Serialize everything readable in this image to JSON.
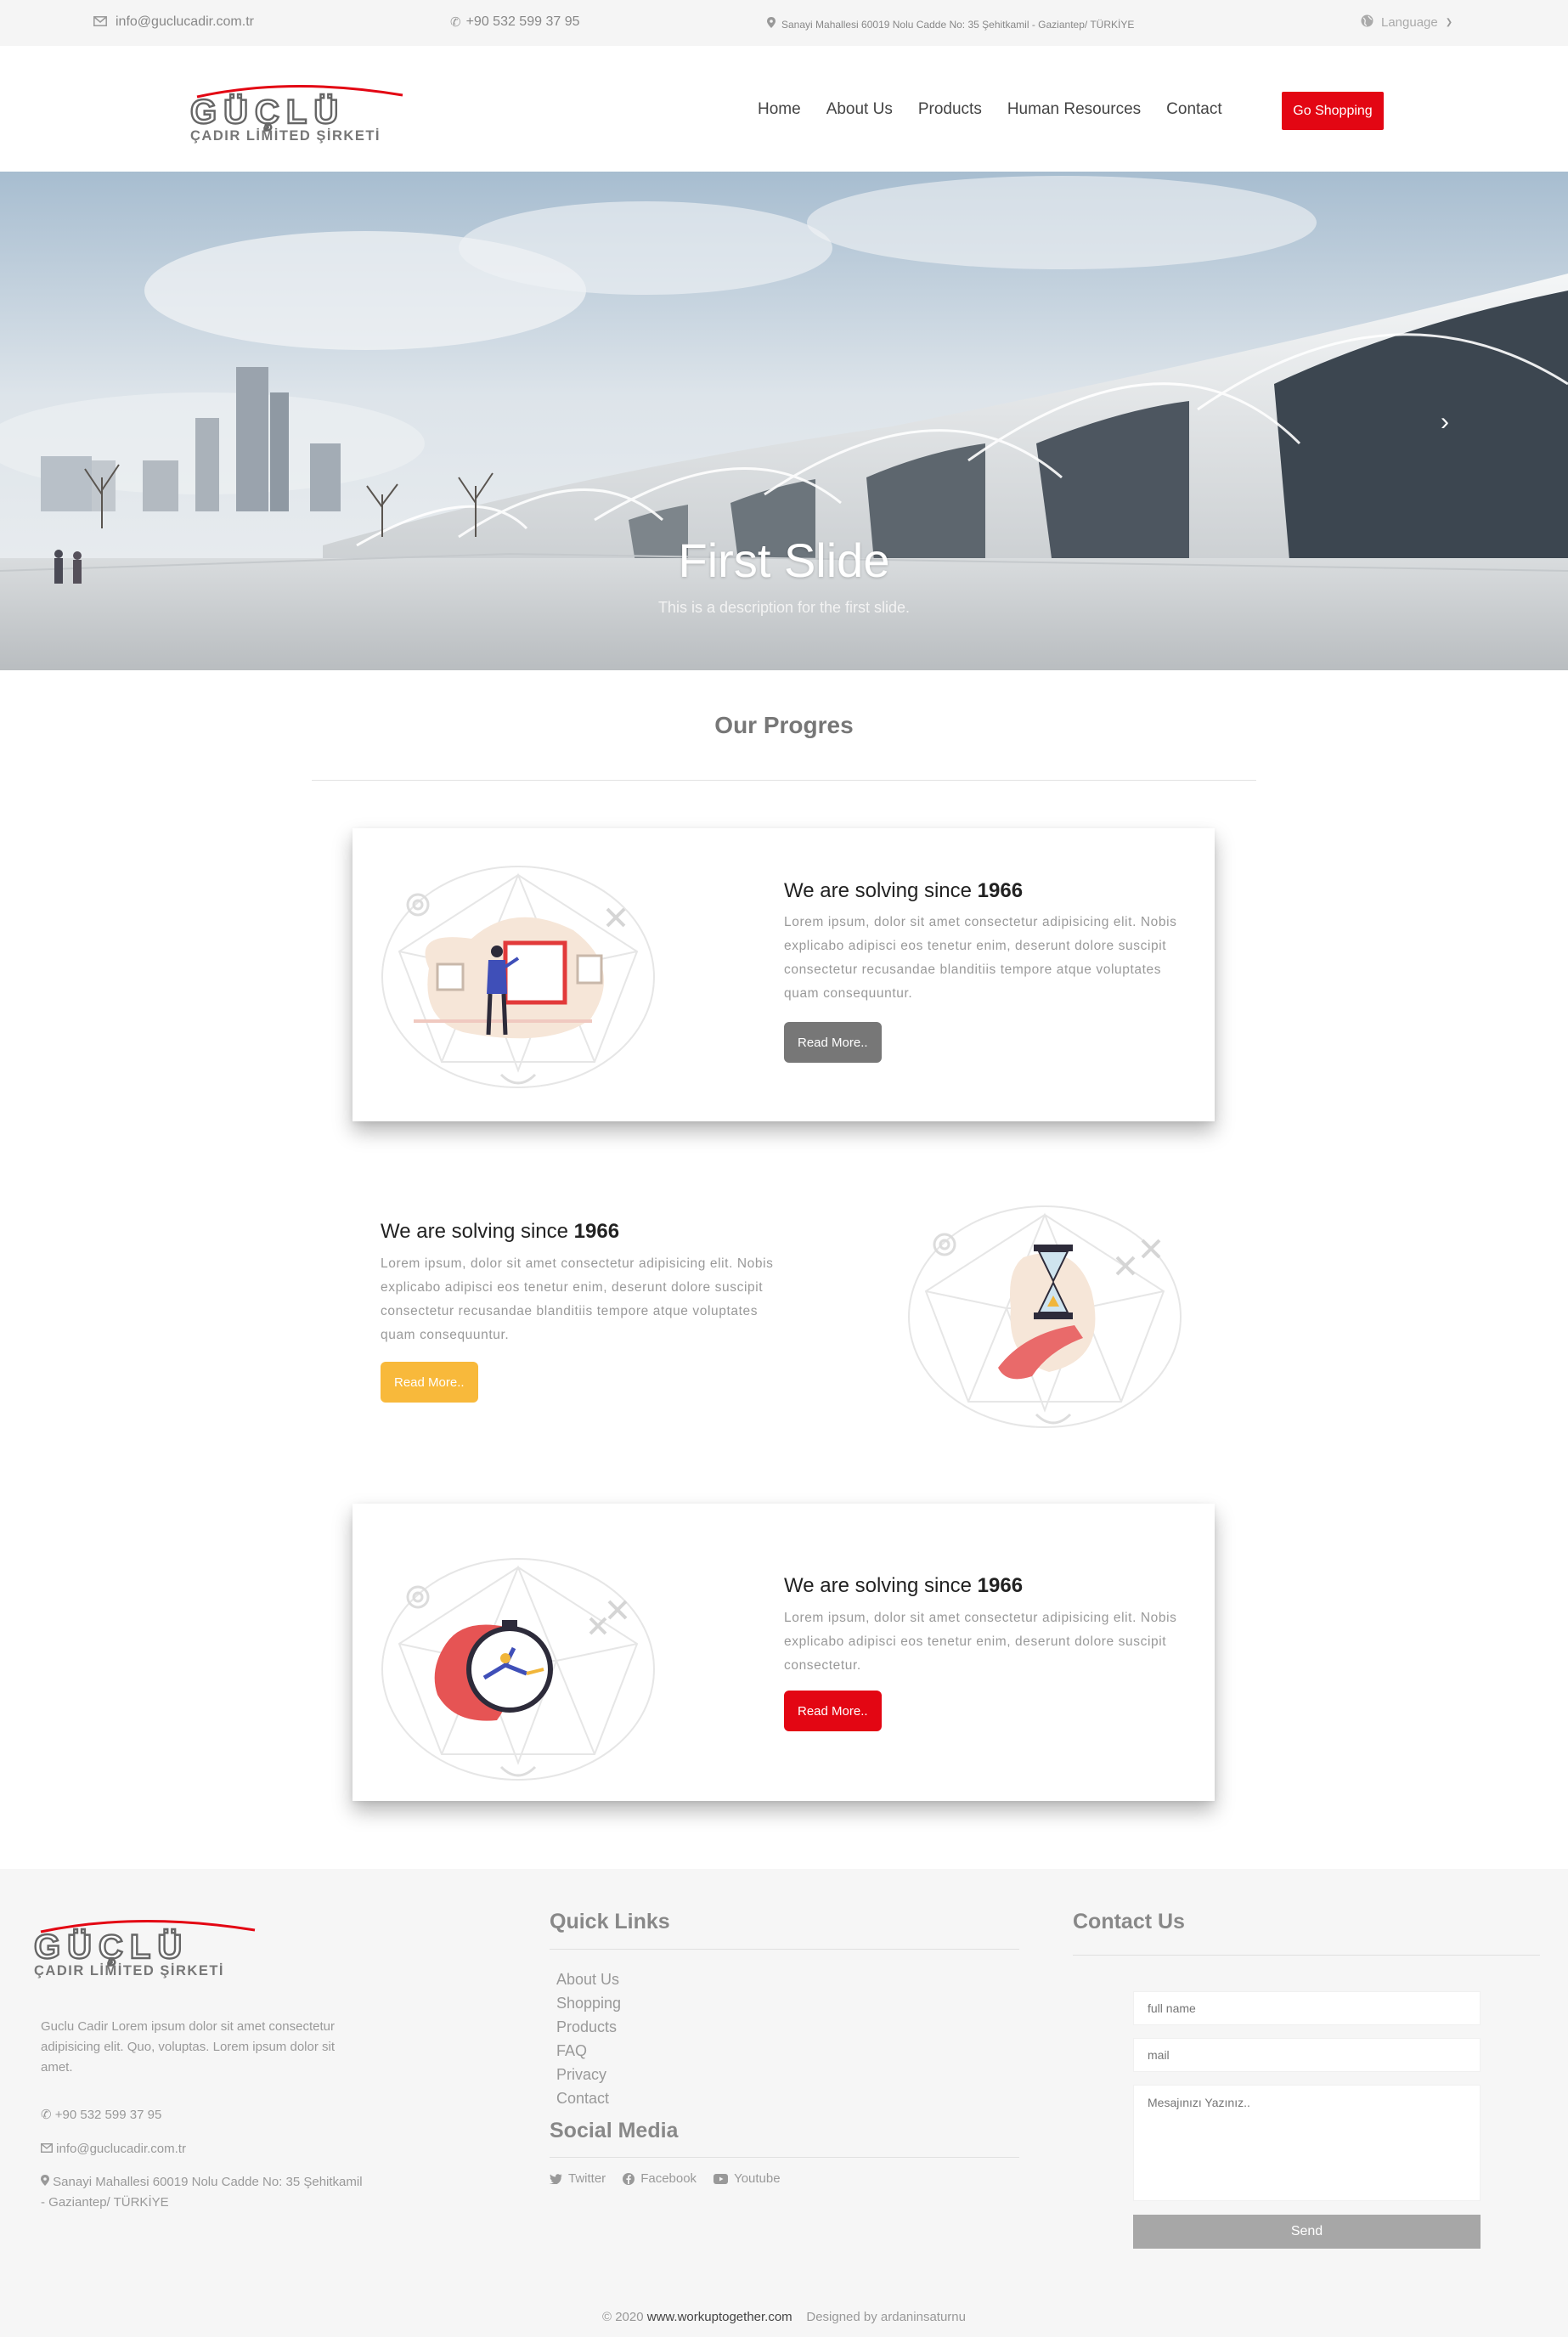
{
  "topbar": {
    "email": "info@guclucadir.com.tr",
    "phone": "+90 532 599 37 95",
    "address": "Sanayi Mahallesi 60019 Nolu Cadde No: 35 Şehitkamil - Gaziantep/ TÜRKİYE",
    "language": "Language"
  },
  "brand": {
    "name": "GÜÇLÜ",
    "subtitle": "ÇADIR LİMİTED ŞİRKETİ",
    "accent": "#e30613"
  },
  "nav": {
    "items": [
      "Home",
      "About Us",
      "Products",
      "Human Resources",
      "Contact"
    ],
    "shop_label": "Go Shopping"
  },
  "hero": {
    "title": "First Slide",
    "description": "This is a description for the first slide."
  },
  "progress": {
    "title": "Our Progres",
    "cards": [
      {
        "title_prefix": "We are solving since",
        "year": "1966",
        "text": "Lorem ipsum, dolor sit amet consectetur adipisicing elit. Nobis explicabo adipisci eos tenetur enim, deserunt dolore suscipit consectetur recusandae blanditiis tempore atque voluptates quam consequuntur.",
        "button": "Read More..",
        "button_color": "#777777",
        "illustration": "gallery-visitor-illustration"
      },
      {
        "title_prefix": "We are solving since",
        "year": "1966",
        "text": "Lorem ipsum, dolor sit amet consectetur adipisicing elit. Nobis explicabo adipisci eos tenetur enim, deserunt dolore suscipit consectetur recusandae blanditiis tempore atque voluptates quam consequuntur.",
        "button": "Read More..",
        "button_color": "#f8b93b",
        "illustration": "hourglass-hand-illustration"
      },
      {
        "title_prefix": "We are solving since",
        "year": "1966",
        "text": "Lorem ipsum, dolor sit amet consectetur adipisicing elit. Nobis explicabo adipisci eos tenetur enim, deserunt dolore suscipit consectetur.",
        "button": "Read More..",
        "button_color": "#e30613",
        "illustration": "stopwatch-runner-illustration"
      }
    ]
  },
  "footer": {
    "about": "Guclu Cadir Lorem ipsum dolor sit amet consectetur adipisicing elit. Quo, voluptas. Lorem ipsum dolor sit amet.",
    "phone": "+90 532 599 37 95",
    "email": "info@guclucadir.com.tr",
    "address": "Sanayi Mahallesi 60019 Nolu Cadde No: 35 Şehitkamil - Gaziantep/ TÜRKİYE",
    "quick_links_title": "Quick Links",
    "quick_links": [
      "About Us",
      "Shopping",
      "Products",
      "FAQ",
      "Privacy",
      "Contact"
    ],
    "social_title": "Social Media",
    "social": [
      "Twitter",
      "Facebook",
      "Youtube"
    ],
    "contact_title": "Contact Us",
    "form": {
      "name_placeholder": "full name",
      "mail_placeholder": "mail",
      "message_placeholder": "Mesajınızı Yazınız..",
      "send_label": "Send"
    },
    "copyright_prefix": "© 2020",
    "copyright_site": "www.workuptogether.com",
    "designed_by": "Designed by ardaninsaturnu"
  }
}
